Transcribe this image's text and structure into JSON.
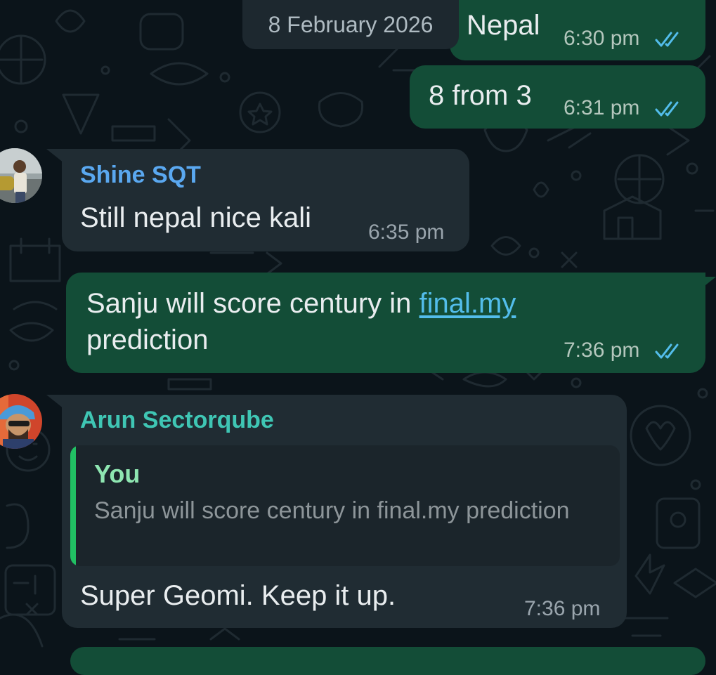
{
  "date_chip": "8 February 2026",
  "colors": {
    "background": "#0b141a",
    "outgoing_bubble": "#134d37",
    "incoming_bubble": "#202c33",
    "read_ticks": "#53bdeb",
    "sender_shine": "#5aa8f0",
    "sender_arun": "#3fc6b4",
    "quote_bar": "#21c063",
    "quote_author": "#8ee6b1"
  },
  "messages": [
    {
      "direction": "outgoing",
      "text": "Nepal",
      "time": "6:30 pm",
      "status_icon": "double-check-read-icon"
    },
    {
      "direction": "outgoing",
      "text": "8 from 3",
      "time": "6:31 pm",
      "status_icon": "double-check-read-icon"
    },
    {
      "direction": "incoming",
      "sender": "Shine SQT",
      "text": "Still nepal nice kali",
      "time": "6:35 pm"
    },
    {
      "direction": "outgoing",
      "text_line1_before_link": "Sanju will score century in ",
      "text_link": "final.my",
      "text_line2": "prediction",
      "time": "7:36 pm",
      "status_icon": "double-check-read-icon"
    },
    {
      "direction": "incoming",
      "sender": "Arun Sectorqube",
      "quote": {
        "author": "You",
        "text": "Sanju will score century in final.my prediction"
      },
      "text": "Super Geomi. Keep it up.",
      "time": "7:36 pm"
    }
  ]
}
